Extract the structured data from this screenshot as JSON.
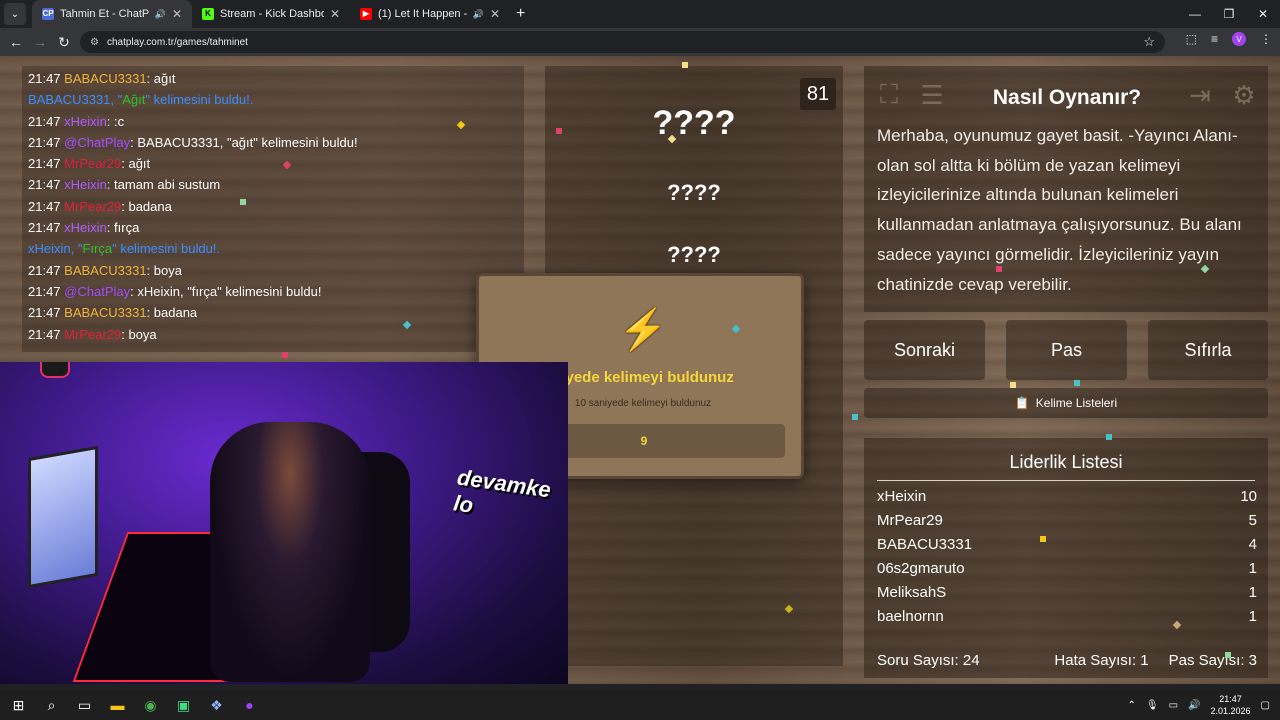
{
  "browser": {
    "tabs": [
      {
        "title": "Tahmin Et - ChatPlay",
        "fav": "CP",
        "fav_color": "#4b6bd6",
        "active": true
      },
      {
        "title": "Stream - Kick Dashboard",
        "fav": "K",
        "fav_color": "#53fc18",
        "active": false
      },
      {
        "title": "(1) Let It Happen - YouTube",
        "fav": "▶",
        "fav_color": "#ff0000",
        "active": false
      }
    ],
    "url": "chatplay.com.tr/games/tahminet",
    "profile_initial": "V"
  },
  "chat": {
    "messages": [
      {
        "type": "msg",
        "time": "21:47",
        "user": "BABACU3331",
        "color": "#f0b43c",
        "text": ": ağıt"
      },
      {
        "type": "found",
        "user": "BABACU3331",
        "word": "Ağıt",
        "pre": ", \"",
        "post": "\" kelimesini buldu!."
      },
      {
        "type": "msg",
        "time": "21:47",
        "user": "xHeixin",
        "color": "#b05bff",
        "text": ": :c"
      },
      {
        "type": "msg",
        "time": "21:47",
        "user": "@ChatPlay",
        "color": "#a64dff",
        "text": ": BABACU3331, \"ağıt\" kelimesini buldu!"
      },
      {
        "type": "msg",
        "time": "21:47",
        "user": "MrPear29",
        "color": "#e0203a",
        "text": ": ağıt"
      },
      {
        "type": "msg",
        "time": "21:47",
        "user": "xHeixin",
        "color": "#b05bff",
        "text": ": tamam abi sustum"
      },
      {
        "type": "msg",
        "time": "21:47",
        "user": "MrPear29",
        "color": "#e0203a",
        "text": ": badana"
      },
      {
        "type": "msg",
        "time": "21:47",
        "user": "xHeixin",
        "color": "#b05bff",
        "text": ": fırça"
      },
      {
        "type": "found",
        "user": "xHeixin",
        "word": "Fırça",
        "pre": ", \"",
        "post": "\" kelimesini buldu!."
      },
      {
        "type": "msg",
        "time": "21:47",
        "user": "BABACU3331",
        "color": "#f0b43c",
        "text": ": boya"
      },
      {
        "type": "msg",
        "time": "21:47",
        "user": "@ChatPlay",
        "color": "#a64dff",
        "text": ": xHeixin, \"fırça\" kelimesini buldu!"
      },
      {
        "type": "msg",
        "time": "21:47",
        "user": "BABACU3331",
        "color": "#f0b43c",
        "text": ": badana"
      },
      {
        "type": "msg",
        "time": "21:47",
        "user": "MrPear29",
        "color": "#e0203a",
        "text": ": boya"
      }
    ]
  },
  "game": {
    "timer": "81",
    "hidden_words": [
      "????",
      "????",
      "????"
    ]
  },
  "modal": {
    "icon": "⚡",
    "title": "niyede kelimeyi buldunuz",
    "subtitle": "10 saniyede kelimeyi buldunuz",
    "bar_value": "9"
  },
  "webcam": {
    "sign": "devamke lo"
  },
  "howto": {
    "title": "Nasıl Oynanır?",
    "text": "Merhaba, oyunumuz gayet basit. -Yayıncı Alanı- olan sol altta ki bölüm de yazan kelimeyi izleyicilerinize altında bulunan kelimeleri kullanmadan anlatmaya çalışıyorsunuz. Bu alanı sadece yayıncı görmelidir. İzleyicileriniz yayın chatinizde cevap verebilir."
  },
  "controls": {
    "next": "Sonraki",
    "pass": "Pas",
    "reset": "Sıfırla",
    "word_lists": "Kelime Listeleri"
  },
  "leaderboard": {
    "title": "Liderlik Listesi",
    "rows": [
      {
        "name": "xHeixin",
        "score": "10"
      },
      {
        "name": "MrPear29",
        "score": "5"
      },
      {
        "name": "BABACU3331",
        "score": "4"
      },
      {
        "name": "06s2gmaruto",
        "score": "1"
      },
      {
        "name": "MeliksahS",
        "score": "1"
      },
      {
        "name": "baelnornn",
        "score": "1"
      }
    ],
    "question_count": "Soru Sayısı: 24",
    "error_count": "Hata Sayısı: 1",
    "pass_count": "Pas Sayısı: 3"
  },
  "taskbar": {
    "time": "21:47",
    "date": "2.01.2026"
  }
}
